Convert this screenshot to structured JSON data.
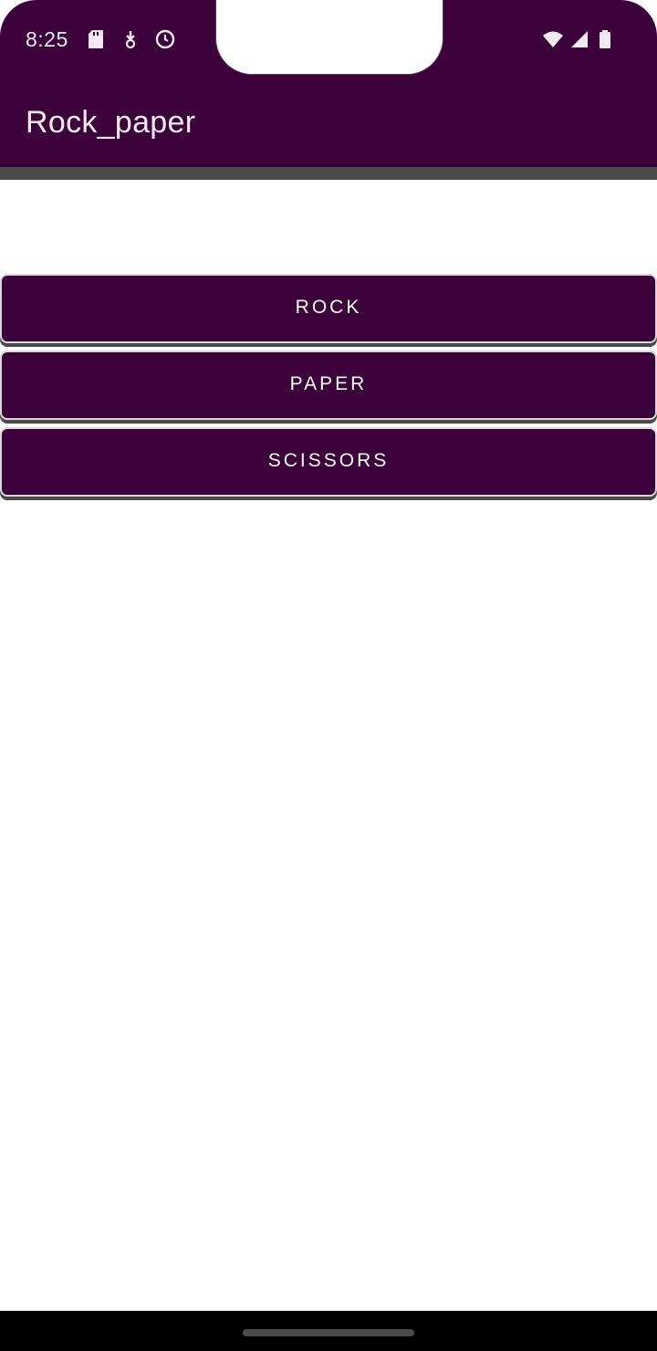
{
  "status_bar": {
    "time": "8:25",
    "left_icons": [
      "sd-card-icon",
      "download-icon",
      "timer-icon"
    ],
    "right_icons": [
      "wifi-icon",
      "cell-signal-icon",
      "battery-icon"
    ]
  },
  "app_bar": {
    "title": "Rock_paper"
  },
  "buttons": [
    {
      "label": "ROCK"
    },
    {
      "label": "PAPER"
    },
    {
      "label": "SCISSORS"
    }
  ],
  "colors": {
    "primary": "#3c003b",
    "on_primary": "#ffffff",
    "background": "#ffffff"
  }
}
